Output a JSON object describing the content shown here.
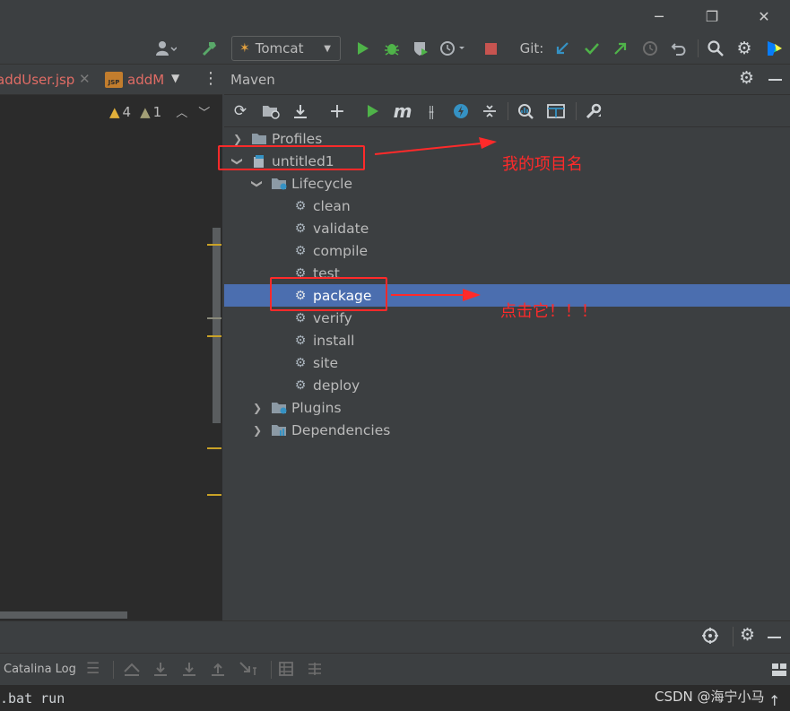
{
  "window": {
    "minimize_glyph": "─",
    "restore_glyph": "❐",
    "close_glyph": "✕"
  },
  "toolbar": {
    "run_config": "Tomcat",
    "git_label": "Git:"
  },
  "editor": {
    "tabs": [
      {
        "label": "addUser.jsp"
      },
      {
        "label": "addM"
      }
    ],
    "warnings_count": "4",
    "weak_warnings_count": "1"
  },
  "maven": {
    "title": "Maven",
    "tree": [
      {
        "label": "Profiles"
      },
      {
        "label": "untitled1"
      },
      {
        "label": "Lifecycle"
      },
      {
        "label": "clean"
      },
      {
        "label": "validate"
      },
      {
        "label": "compile"
      },
      {
        "label": "test"
      },
      {
        "label": "package"
      },
      {
        "label": "verify"
      },
      {
        "label": "install"
      },
      {
        "label": "site"
      },
      {
        "label": "deploy"
      },
      {
        "label": "Plugins"
      },
      {
        "label": "Dependencies"
      }
    ]
  },
  "bottom": {
    "catalina_log": "Catalina Log",
    "console_line": ".bat run"
  },
  "annotations": {
    "project_name_note": "我的项目名",
    "click_note": "点击它！！！"
  },
  "watermark": "CSDN @海宁小马",
  "colors": {
    "selection": "#4b6eaf",
    "annotation": "#ff2a2a",
    "run_green": "#4fb349",
    "stop_red": "#c75450",
    "git_blue": "#3592c4"
  }
}
